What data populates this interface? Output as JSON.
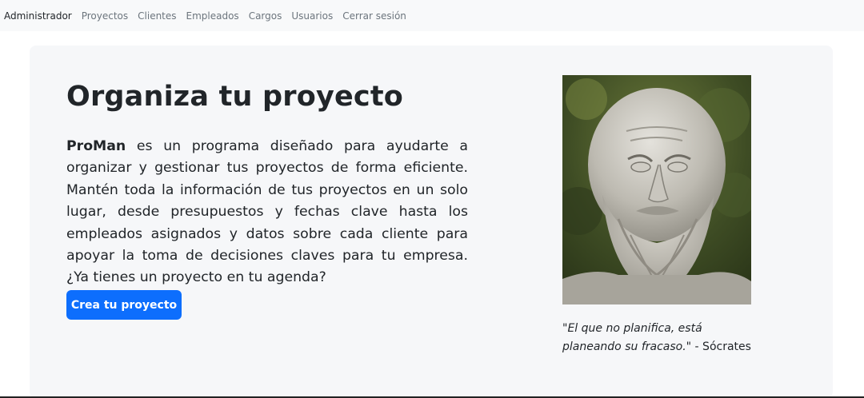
{
  "nav": {
    "brand": "Administrador",
    "links": [
      "Proyectos",
      "Clientes",
      "Empleados",
      "Cargos",
      "Usuarios",
      "Cerrar sesión"
    ]
  },
  "hero": {
    "title": "Organiza tu proyecto",
    "brand_name": "ProMan",
    "description": " es un programa diseñado para ayudarte a organizar y gestionar tus proyectos de forma eficiente. Mantén toda la información de tus proyectos en un solo lugar, desde presupuestos y fechas clave hasta los empleados asignados y datos sobre cada cliente para apoyar la toma de decisiones claves para tu empresa. ¿Ya tienes un proyecto en tu agenda?",
    "cta_label": "Crea tu proyecto"
  },
  "quote": {
    "text": "\"El que no planifica, está planeando su fracaso.\"",
    "author": " - Sócrates"
  },
  "colors": {
    "primary": "#0d6efd",
    "navbar_bg": "#f8f9fa",
    "hero_bg": "#f6f7f9",
    "text": "#212529",
    "muted": "#6c757d"
  }
}
